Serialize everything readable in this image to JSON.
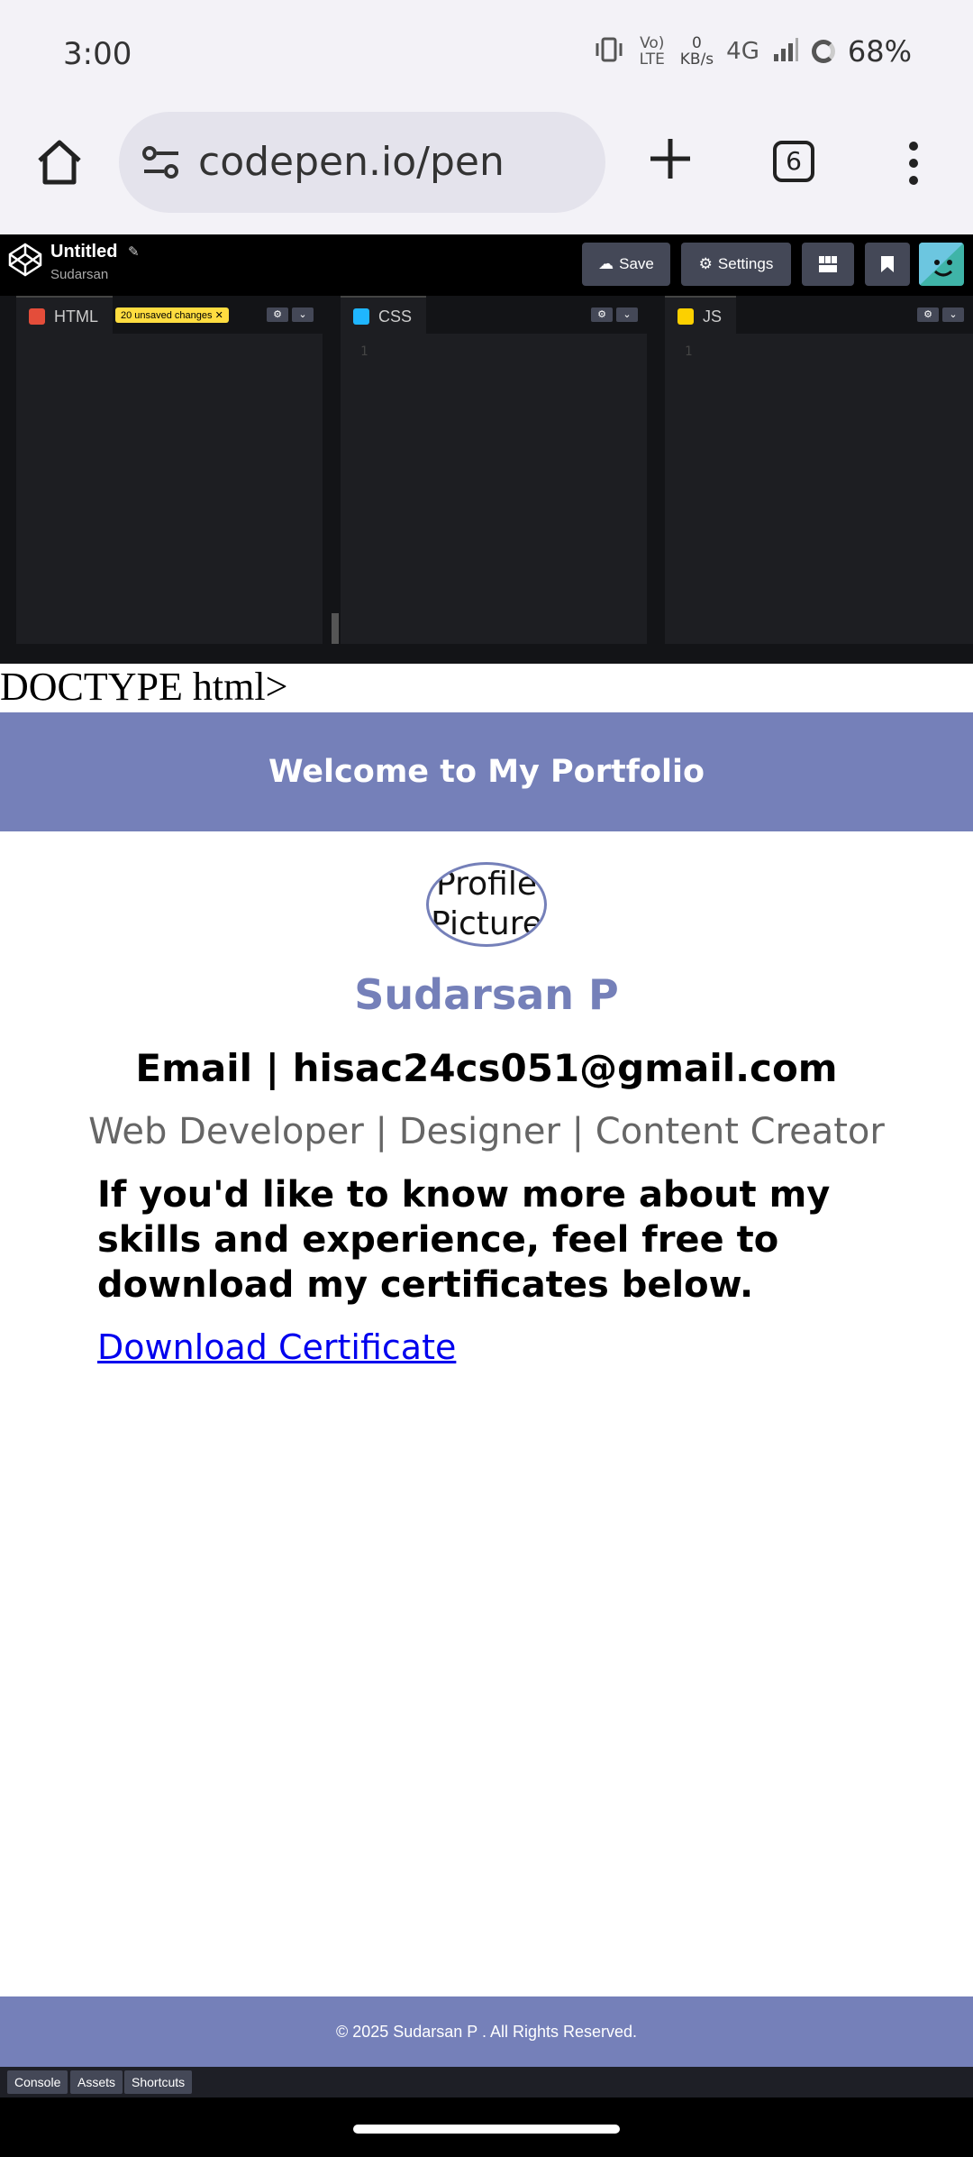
{
  "status_bar": {
    "time": "3:00",
    "volte": "Vo) LTE",
    "data_speed_value": "0",
    "data_speed_unit": "KB/s",
    "network": "4G",
    "battery": "68%"
  },
  "browser": {
    "url": "codepen.io/pen",
    "tab_count": "6"
  },
  "codepen": {
    "title": "Untitled",
    "user": "Sudarsan",
    "save_label": "Save",
    "settings_label": "Settings",
    "panes": {
      "html": {
        "label": "HTML",
        "badge": "20 unsaved changes ✕",
        "line": ""
      },
      "css": {
        "label": "CSS",
        "line": "1"
      },
      "js": {
        "label": "JS",
        "line": "1"
      }
    },
    "bottom": {
      "console": "Console",
      "assets": "Assets",
      "shortcuts": "Shortcuts"
    }
  },
  "preview": {
    "doctype_text": "DOCTYPE html>",
    "header_title": "Welcome to My Portfolio",
    "profile_alt": "Profile Picture",
    "name": "Sudarsan P",
    "email_line": "Email | hisac24cs051@gmail.com",
    "roles": "Web Developer | Designer | Content Creator",
    "intro": "If you'd like to know more about my skills and experience, feel free to download my certificates below.",
    "download_link": "Download Certificate",
    "footer": "© 2025 Sudarsan P . All Rights Reserved."
  },
  "colors": {
    "accent": "#7580b9",
    "codepen_bg": "#131417",
    "badge": "#ffdd40"
  }
}
